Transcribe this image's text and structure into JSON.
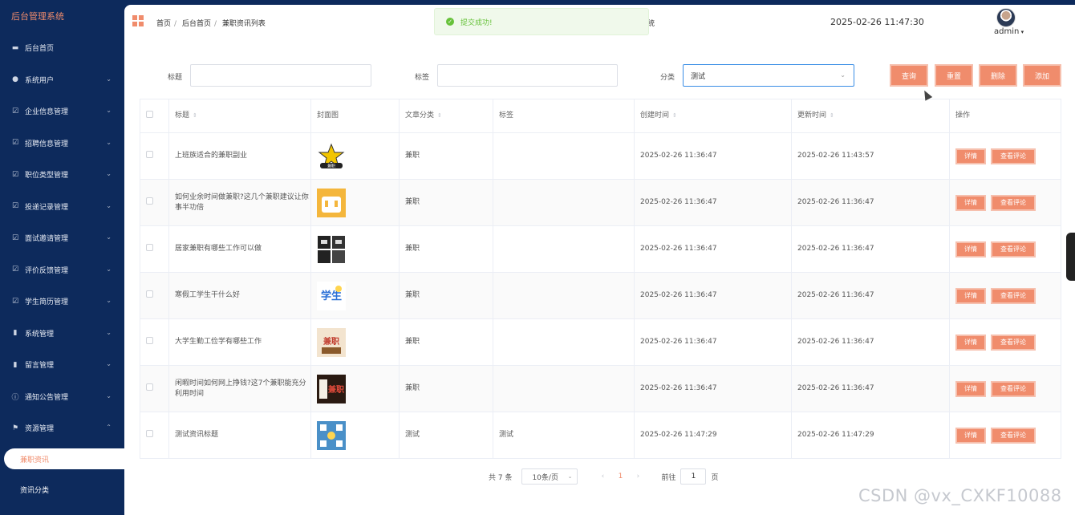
{
  "app": {
    "title": "后台管理系统"
  },
  "sidebar": {
    "items": [
      {
        "label": "后台首页",
        "icon": "monitor-icon",
        "expandable": false
      },
      {
        "label": "系统用户",
        "icon": "user-icon",
        "expandable": true
      },
      {
        "label": "企业信息管理",
        "icon": "checkbox-icon",
        "expandable": true
      },
      {
        "label": "招聘信息管理",
        "icon": "checkbox-icon",
        "expandable": true
      },
      {
        "label": "职位类型管理",
        "icon": "checkbox-icon",
        "expandable": true
      },
      {
        "label": "投递记录管理",
        "icon": "checkbox-icon",
        "expandable": true
      },
      {
        "label": "面试邀请管理",
        "icon": "checkbox-icon",
        "expandable": true
      },
      {
        "label": "评价反馈管理",
        "icon": "checkbox-icon",
        "expandable": true
      },
      {
        "label": "学生简历管理",
        "icon": "checkbox-icon",
        "expandable": true
      },
      {
        "label": "系统管理",
        "icon": "bar-chart-icon",
        "expandable": true
      },
      {
        "label": "留言管理",
        "icon": "bar-chart-icon",
        "expandable": true
      },
      {
        "label": "通知公告管理",
        "icon": "info-icon",
        "expandable": true
      },
      {
        "label": "资源管理",
        "icon": "flag-icon",
        "expandable": true,
        "expanded": true
      }
    ],
    "subitems": [
      {
        "label": "兼职资讯",
        "active": true
      },
      {
        "label": "资讯分类",
        "active": false
      }
    ]
  },
  "header": {
    "breadcrumb": [
      "首页",
      "后台首页",
      "兼职资讯列表"
    ],
    "system_name_fragment": "统",
    "datetime": "2025-02-26 11:47:30",
    "username": "admin"
  },
  "toast": {
    "message": "提交成功!",
    "type": "success"
  },
  "filters": {
    "title_label": "标题",
    "title_value": "",
    "tag_label": "标签",
    "tag_value": "",
    "category_label": "分类",
    "category_value": "测试"
  },
  "actions": {
    "search": "查询",
    "reset": "重置",
    "delete": "删除",
    "add": "添加"
  },
  "table": {
    "columns": [
      "标题",
      "封面图",
      "文章分类",
      "标签",
      "创建时间",
      "更新时间",
      "操作"
    ],
    "rows": [
      {
        "title": "上班族适合的兼职副业",
        "category": "兼职",
        "tag": "",
        "created": "2025-02-26 11:36:47",
        "updated": "2025-02-26 11:43:57"
      },
      {
        "title": "如何业余时间做兼职?这几个兼职建议让你事半功倍",
        "category": "兼职",
        "tag": "",
        "created": "2025-02-26 11:36:47",
        "updated": "2025-02-26 11:36:47"
      },
      {
        "title": "居家兼职有哪些工作可以做",
        "category": "兼职",
        "tag": "",
        "created": "2025-02-26 11:36:47",
        "updated": "2025-02-26 11:36:47"
      },
      {
        "title": "寒假工学生干什么好",
        "category": "兼职",
        "tag": "",
        "created": "2025-02-26 11:36:47",
        "updated": "2025-02-26 11:36:47"
      },
      {
        "title": "大学生勤工俭学有哪些工作",
        "category": "兼职",
        "tag": "",
        "created": "2025-02-26 11:36:47",
        "updated": "2025-02-26 11:36:47"
      },
      {
        "title": "闲暇时间如何网上挣钱?这7个兼职能充分利用时间",
        "category": "兼职",
        "tag": "",
        "created": "2025-02-26 11:36:47",
        "updated": "2025-02-26 11:36:47"
      },
      {
        "title": "测试资讯标题",
        "category": "测试",
        "tag": "测试",
        "created": "2025-02-26 11:47:29",
        "updated": "2025-02-26 11:47:29"
      }
    ],
    "row_actions": {
      "detail": "详情",
      "comments": "查看评论"
    },
    "thumbs": [
      "兼职",
      "",
      "",
      "学生",
      "兼职",
      "兼职",
      ""
    ]
  },
  "pagination": {
    "total": "共 7 条",
    "page_size": "10条/页",
    "current_page": "1",
    "goto_label": "前往",
    "goto_value": "1",
    "page_suffix": "页"
  },
  "watermark": "CSDN @vx_CXKF10088",
  "colors": {
    "accent": "#f08c6c",
    "sidebar_bg": "#0d2a5c",
    "success": "#67c23a"
  }
}
